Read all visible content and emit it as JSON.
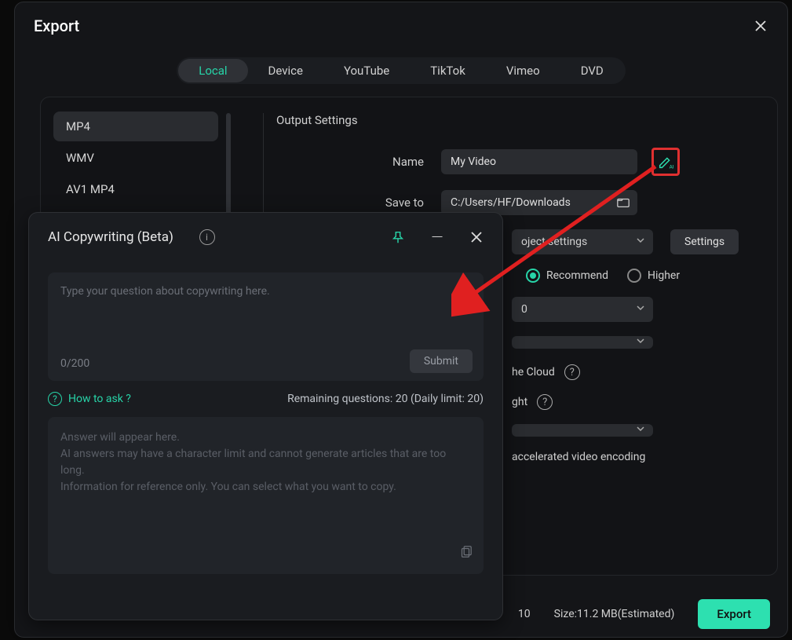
{
  "dialog": {
    "title": "Export"
  },
  "tabs": [
    "Local",
    "Device",
    "YouTube",
    "TikTok",
    "Vimeo",
    "DVD"
  ],
  "active_tab": 0,
  "formats": [
    "MP4",
    "WMV",
    "AV1 MP4"
  ],
  "active_format": 0,
  "settings": {
    "section_title": "Output Settings",
    "name_label": "Name",
    "name_value": "My Video",
    "saveto_label": "Save to",
    "saveto_value": "C:/Users/HF/Downloads",
    "preset_value_partial": "oject settings",
    "settings_btn": "Settings",
    "quality_recommend": "Recommend",
    "quality_higher": "Higher",
    "dropdown_a_partial": "0",
    "cloud_partial": "he Cloud",
    "light_partial": "ght",
    "hw_encoding_partial": "accelerated video encoding"
  },
  "bottom": {
    "number_partial": "10",
    "size_label": "Size:",
    "size_value": "11.2 MB(Estimated)",
    "export_btn": "Export"
  },
  "ai": {
    "title": "AI Copywriting (Beta)",
    "placeholder": "Type your question about copywriting here.",
    "counter": "0/200",
    "submit": "Submit",
    "howto": "How to ask ?",
    "remaining": "Remaining questions: 20 (Daily limit: 20)",
    "answer_line1": "Answer will appear here.",
    "answer_line2": "AI answers may have a character limit and cannot generate articles that are too long.",
    "answer_line3": "Information for reference only. You can select what you want to copy."
  }
}
